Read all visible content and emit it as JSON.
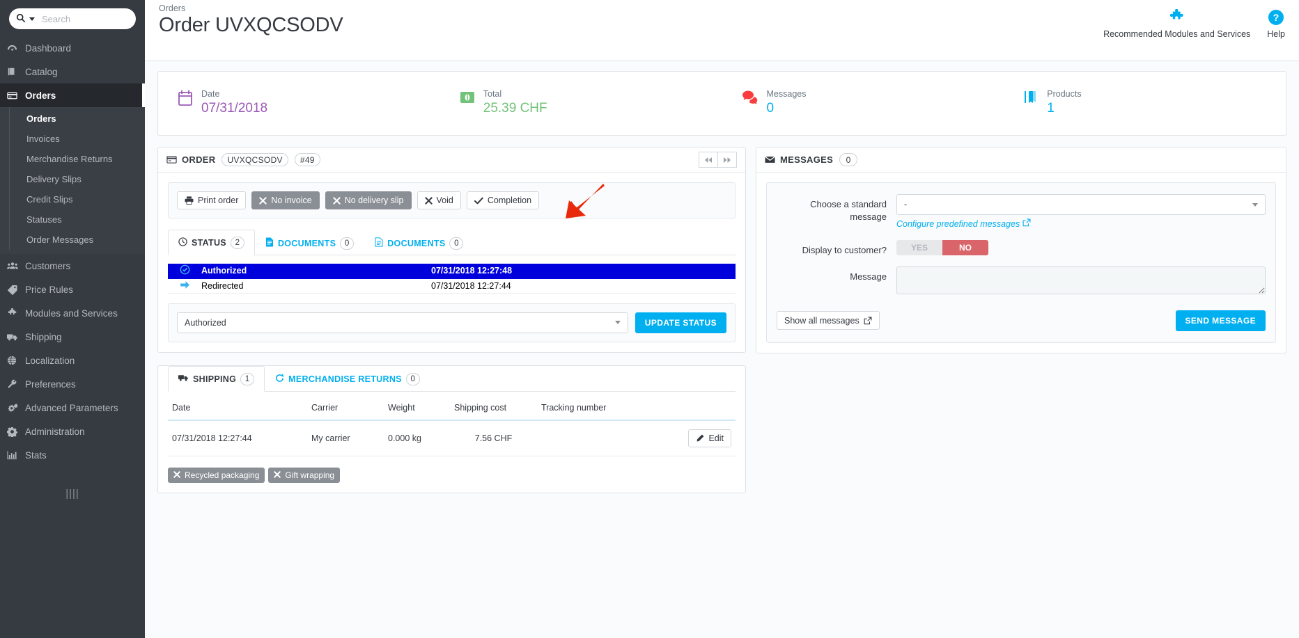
{
  "sidebar": {
    "search": {
      "placeholder": "Search",
      "value": ""
    },
    "items": [
      {
        "label": "Dashboard",
        "icon": "dashboard-icon",
        "active": false
      },
      {
        "label": "Catalog",
        "icon": "catalog-icon",
        "active": false
      },
      {
        "label": "Orders",
        "icon": "orders-icon",
        "active": true
      },
      {
        "label": "Customers",
        "icon": "customers-icon",
        "active": false
      },
      {
        "label": "Price Rules",
        "icon": "tag-icon",
        "active": false
      },
      {
        "label": "Modules and Services",
        "icon": "puzzle-icon",
        "active": false
      },
      {
        "label": "Shipping",
        "icon": "truck-icon",
        "active": false
      },
      {
        "label": "Localization",
        "icon": "globe-icon",
        "active": false
      },
      {
        "label": "Preferences",
        "icon": "wrench-icon",
        "active": false
      },
      {
        "label": "Advanced Parameters",
        "icon": "cogs-icon",
        "active": false
      },
      {
        "label": "Administration",
        "icon": "gear-icon",
        "active": false
      },
      {
        "label": "Stats",
        "icon": "chart-icon",
        "active": false
      }
    ],
    "submenu": [
      {
        "label": "Orders",
        "active": true
      },
      {
        "label": "Invoices",
        "active": false
      },
      {
        "label": "Merchandise Returns",
        "active": false
      },
      {
        "label": "Delivery Slips",
        "active": false
      },
      {
        "label": "Credit Slips",
        "active": false
      },
      {
        "label": "Statuses",
        "active": false
      },
      {
        "label": "Order Messages",
        "active": false
      }
    ]
  },
  "header": {
    "breadcrumb": "Orders",
    "title": "Order UVXQCSODV",
    "actions": [
      {
        "label": "Recommended Modules and Services",
        "icon": "puzzle-icon"
      },
      {
        "label": "Help",
        "icon": "help-icon"
      }
    ]
  },
  "kpis": [
    {
      "label": "Date",
      "value": "07/31/2018",
      "icon": "calendar-icon",
      "color": "purple"
    },
    {
      "label": "Total",
      "value": "25.39 CHF",
      "icon": "money-icon",
      "color": "green"
    },
    {
      "label": "Messages",
      "value": "0",
      "icon": "comments-icon",
      "color": "blue"
    },
    {
      "label": "Products",
      "value": "1",
      "icon": "book-icon",
      "color": "blue"
    }
  ],
  "order_panel": {
    "title": "ORDER",
    "reference": "UVXQCSODV",
    "number": "#49",
    "prev_label": "◀◀",
    "next_label": "▶▶",
    "actions": [
      {
        "label": "Print order",
        "icon": "printer-icon",
        "style": "default"
      },
      {
        "label": "No invoice",
        "icon": "times-icon",
        "style": "gray"
      },
      {
        "label": "No delivery slip",
        "icon": "times-icon",
        "style": "gray"
      },
      {
        "label": "Void",
        "icon": "times-icon",
        "style": "default"
      },
      {
        "label": "Completion",
        "icon": "check-icon",
        "style": "default"
      }
    ],
    "tabs": [
      {
        "label": "STATUS",
        "count": "2",
        "icon": "clock-icon",
        "active": true
      },
      {
        "label": "DOCUMENTS",
        "count": "0",
        "icon": "doc-blue-icon",
        "active": false
      },
      {
        "label": "DOCUMENTS",
        "count": "0",
        "icon": "doc-line-icon",
        "active": false
      }
    ],
    "statuses": [
      {
        "name": "Authorized",
        "date": "07/31/2018 12:27:48",
        "icon": "check-circle-icon",
        "selected": true
      },
      {
        "name": "Redirected",
        "date": "07/31/2018 12:27:44",
        "icon": "arrow-right-icon",
        "selected": false
      }
    ],
    "status_select": {
      "value": "Authorized"
    },
    "update_button": "Update status"
  },
  "shipping_panel": {
    "tabs": [
      {
        "label": "SHIPPING",
        "count": "1",
        "icon": "truck-icon",
        "active": true
      },
      {
        "label": "MERCHANDISE RETURNS",
        "count": "0",
        "icon": "refresh-icon",
        "active": false
      }
    ],
    "columns": [
      "Date",
      "Carrier",
      "Weight",
      "Shipping cost",
      "Tracking number"
    ],
    "rows": [
      {
        "date": "07/31/2018 12:27:44",
        "carrier": "My carrier",
        "weight": "0.000 kg",
        "cost": "7.56 CHF",
        "tracking": "",
        "action": "Edit"
      }
    ],
    "tags": [
      {
        "label": "Recycled packaging",
        "icon": "times-icon"
      },
      {
        "label": "Gift wrapping",
        "icon": "times-icon"
      }
    ]
  },
  "messages_panel": {
    "title": "MESSAGES",
    "count": "0",
    "standard_message_label": "Choose a standard message",
    "standard_message_value": "-",
    "configure_link": "Configure predefined messages",
    "display_label": "Display to customer?",
    "toggle_yes": "YES",
    "toggle_no": "NO",
    "message_label": "Message",
    "message_value": "",
    "show_all_label": "Show all messages",
    "send_label": "Send message"
  }
}
